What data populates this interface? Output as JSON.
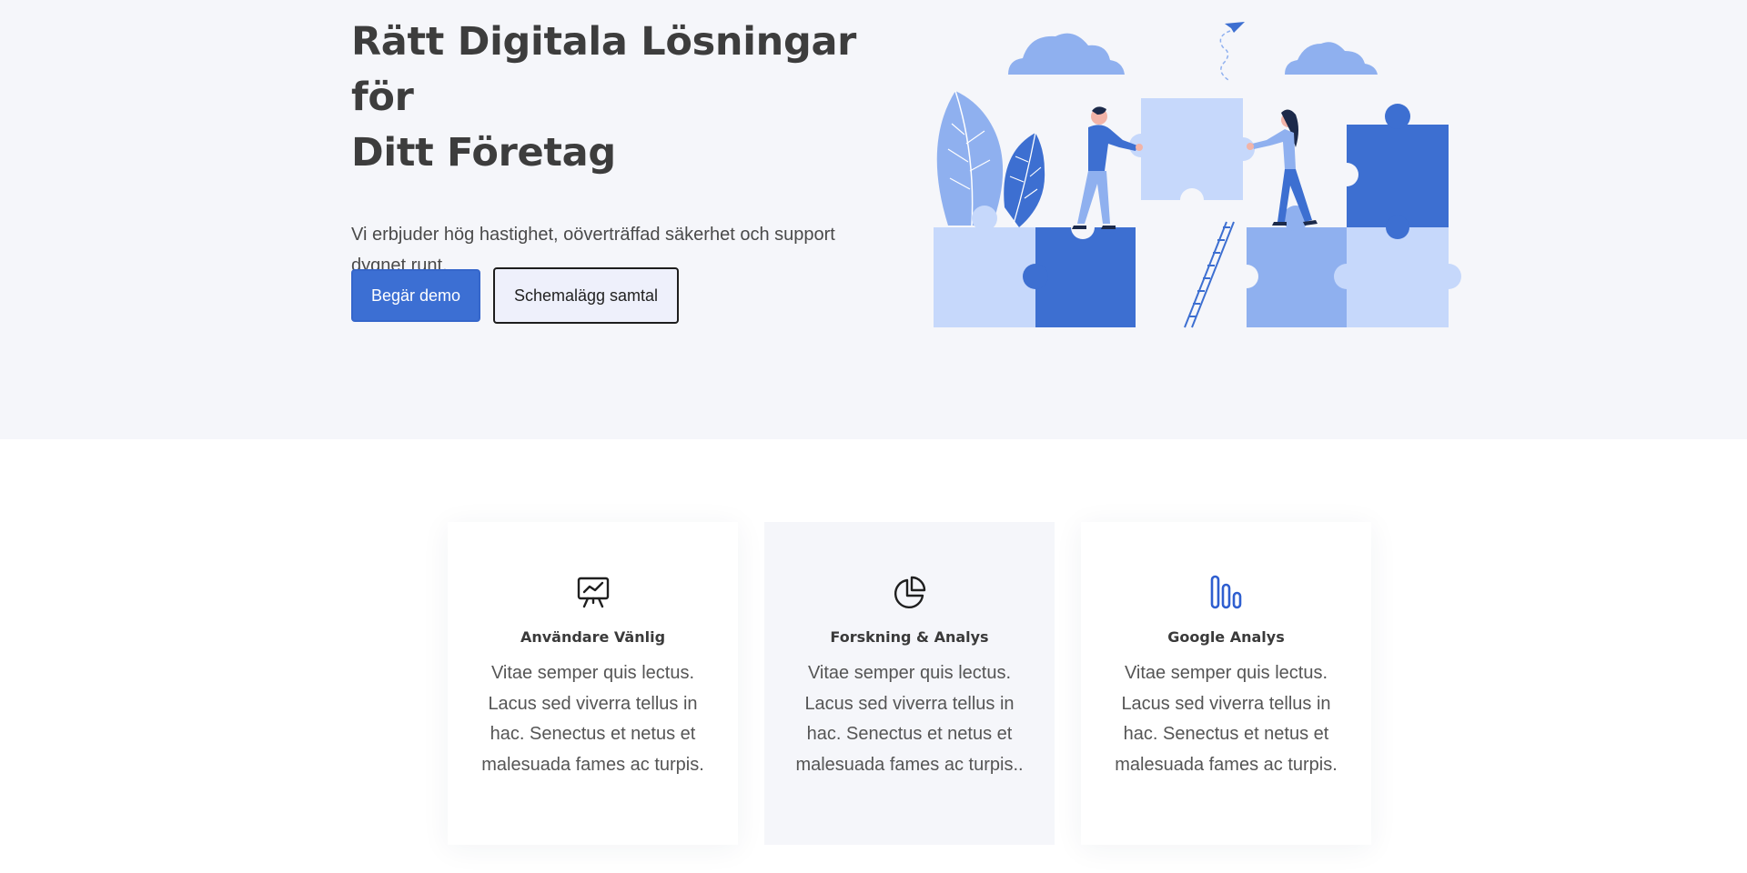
{
  "hero": {
    "title_line1": "Rätt Digitala Lösningar för",
    "title_line2": "Ditt Företag",
    "subtitle": "Vi erbjuder hög hastighet, oöverträffad säkerhet och support dygnet runt.",
    "primary_button": "Begär demo",
    "secondary_button": "Schemalägg samtal",
    "illustration": "puzzle-teamwork-illustration"
  },
  "features": [
    {
      "icon": "presentation-chart-icon",
      "title": "Användare Vänlig",
      "text": "Vitae semper quis lectus. Lacus sed viverra tellus in hac. Senectus et netus et malesuada fames ac turpis."
    },
    {
      "icon": "pie-chart-icon",
      "title": "Forskning & Analys",
      "text": "Vitae semper quis lectus. Lacus sed viverra tellus in hac. Senectus et netus et malesuada fames ac turpis.."
    },
    {
      "icon": "bar-chart-icon",
      "title": "Google Analys",
      "text": "Vitae semper quis lectus. Lacus sed viverra tellus in hac. Senectus et netus et malesuada fames ac turpis."
    }
  ],
  "colors": {
    "accent": "#3c6fd3",
    "hero_background": "#f5f6fa",
    "puzzle_dark": "#3d6fd1",
    "puzzle_mid": "#8fb0ef",
    "puzzle_light": "#c6d8fb"
  }
}
